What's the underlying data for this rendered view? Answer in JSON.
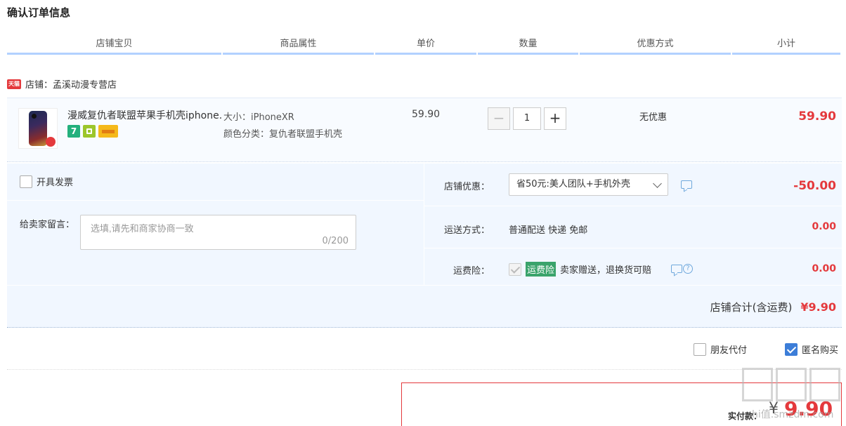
{
  "page_title": "确认订单信息",
  "columns": [
    "店铺宝贝",
    "商品属性",
    "单价",
    "数量",
    "优惠方式",
    "小计"
  ],
  "shop": {
    "badge": "天猫",
    "label": "店铺：孟溪动漫专营店"
  },
  "item": {
    "title": "漫威复仇者联盟苹果手机壳iphone...",
    "attr_size": "大小：iPhoneXR",
    "attr_color": "颜色分类：复仇者联盟手机壳",
    "unit_price": "59.90",
    "quantity": "1",
    "qty_minus": "−",
    "qty_plus": "+",
    "promotion": "无优惠",
    "subtotal": "59.90",
    "icon_seven": "7"
  },
  "invoice": {
    "label": "开具发票",
    "checked": false
  },
  "memo": {
    "label": "给卖家留言：",
    "placeholder": "选填,请先和商家协商一致",
    "count": "0/200"
  },
  "shop_discount": {
    "label": "店铺优惠：",
    "selected": "省50元:美人团队+手机外壳",
    "amount": "-50.00"
  },
  "shipping": {
    "label": "运送方式：",
    "value": "普通配送 快递 免邮",
    "amount": "0.00"
  },
  "insurance": {
    "label": "运费险：",
    "tag": "运费险",
    "desc": "卖家赠送，退换货可赔",
    "amount": "0.00"
  },
  "shop_total": {
    "label": "店铺合计(含运费)",
    "amount": "¥9.90"
  },
  "friend_pay": {
    "label": "朋友代付",
    "checked": false
  },
  "anonymous": {
    "label": "匿名购买",
    "checked": true
  },
  "payment": {
    "label": "实付款：",
    "currency": "¥",
    "amount": "9.90"
  },
  "watermark": "hi值.smzdm.com",
  "colors": {
    "price_red": "#e4393c",
    "header_blue": "#b2d1ff",
    "panel_bg": "#f1f7ff",
    "checkbox_blue": "#3c7dd8"
  }
}
